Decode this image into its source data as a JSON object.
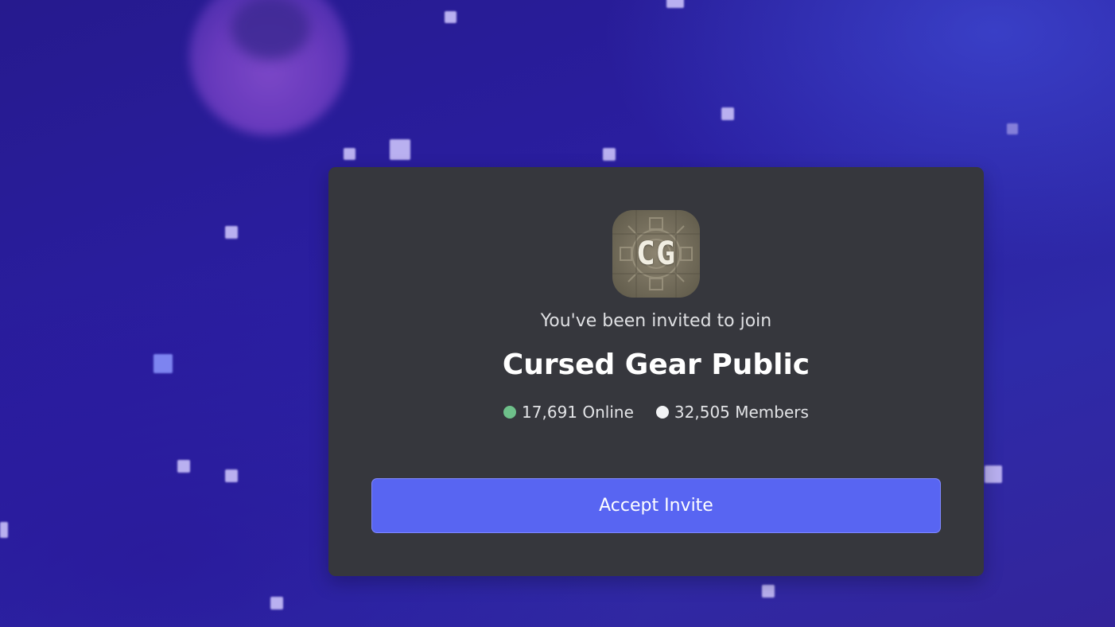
{
  "server": {
    "icon_initials": "CG",
    "name": "Cursed Gear Public"
  },
  "invite": {
    "prompt": "You've been invited to join",
    "accept_label": "Accept Invite"
  },
  "stats": {
    "online": "17,691 Online",
    "members": "32,505 Members"
  },
  "colors": {
    "online_dot": "#6ec08a",
    "members_dot": "#f2f3f5",
    "button": "#5865f2",
    "card": "#36373d"
  }
}
